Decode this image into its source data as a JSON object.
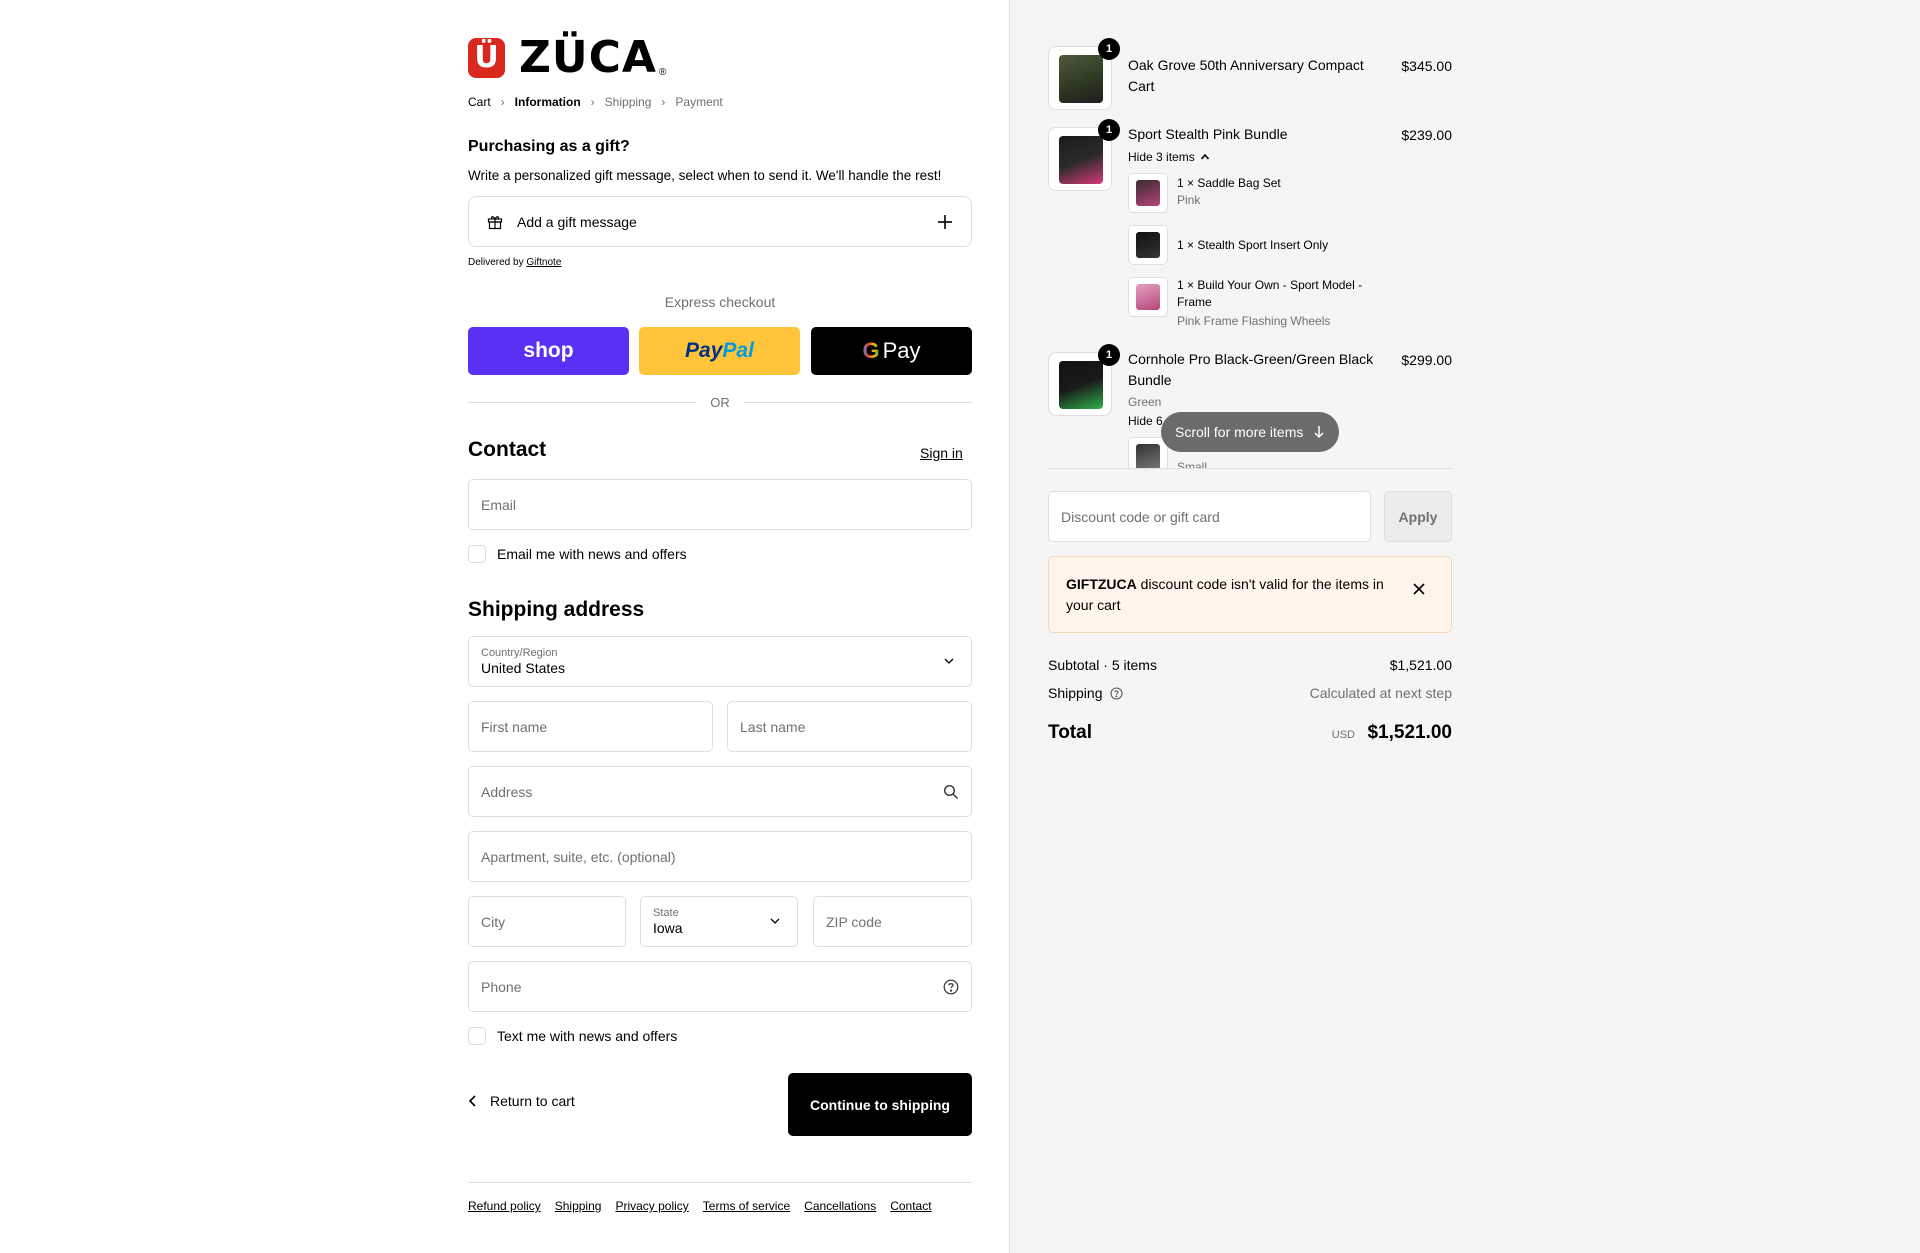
{
  "brand": {
    "logo_mark": "Ü",
    "logo_text": "ZÜCA",
    "reg": "®"
  },
  "breadcrumbs": [
    {
      "label": "Cart",
      "state": "link"
    },
    {
      "label": "Information",
      "state": "active"
    },
    {
      "label": "Shipping",
      "state": "upcoming"
    },
    {
      "label": "Payment",
      "state": "upcoming"
    }
  ],
  "gift": {
    "title": "Purchasing as a gift?",
    "subtitle": "Write a personalized gift message, select when to send it. We'll handle the rest!",
    "add_label": "Add a gift message",
    "delivered_prefix": "Delivered by",
    "delivered_link": "Giftnote"
  },
  "express": {
    "label": "Express checkout",
    "shop": "shop",
    "paypal_a": "Pay",
    "paypal_b": "Pal",
    "gpay_g": "G",
    "gpay_label": "Pay",
    "or": "OR"
  },
  "contact": {
    "title": "Contact",
    "sign_in": "Sign in",
    "email_placeholder": "Email",
    "news_label": "Email me with news and offers"
  },
  "shipping": {
    "title": "Shipping address",
    "country_label": "Country/Region",
    "country_value": "United States",
    "first_name": "First name",
    "last_name": "Last name",
    "address": "Address",
    "apartment": "Apartment, suite, etc. (optional)",
    "city": "City",
    "state_label": "State",
    "state_value": "Iowa",
    "zip": "ZIP code",
    "phone": "Phone",
    "text_label": "Text me with news and offers"
  },
  "actions": {
    "return": "Return to cart",
    "continue": "Continue to shipping"
  },
  "footer_links": [
    "Refund policy",
    "Shipping",
    "Privacy policy",
    "Terms of service",
    "Cancellations",
    "Contact"
  ],
  "order": {
    "items": [
      {
        "qty": "1",
        "name": "Oak Grove 50th Anniversary Compact Cart",
        "price": "$345.00"
      },
      {
        "qty": "1",
        "name": "Sport Stealth Pink Bundle",
        "price": "$239.00",
        "toggle": "Hide 3 items",
        "sub_items": [
          {
            "text": "1 × Saddle Bag Set",
            "variant": "Pink"
          },
          {
            "text": "1 × Stealth Sport Insert Only",
            "variant": ""
          },
          {
            "text": "1 × Build Your Own - Sport Model - Frame",
            "variant": "Pink Frame Flashing Wheels"
          }
        ]
      },
      {
        "qty": "1",
        "name": "Cornhole Pro Black-Green/Green Black Bundle",
        "price": "$299.00",
        "variant": "Green",
        "toggle": "Hide 6",
        "sub_items": [
          {
            "text": "",
            "variant": "Small"
          }
        ]
      }
    ],
    "scroll_hint": "Scroll for more items",
    "discount_placeholder": "Discount code or gift card",
    "apply": "Apply",
    "alert_code": "GIFTZUCA",
    "alert_text": "discount code isn't valid for the items in your cart",
    "subtotal_label": "Subtotal · 5 items",
    "subtotal_value": "$1,521.00",
    "shipping_label": "Shipping",
    "shipping_value": "Calculated at next step",
    "total_label": "Total",
    "currency": "USD",
    "total_value": "$1,521.00"
  },
  "colors": {
    "brand_red": "#d9281e",
    "shop_purple": "#5a31f4",
    "paypal_yellow": "#ffc439",
    "alert_bg": "#fff5ea"
  }
}
